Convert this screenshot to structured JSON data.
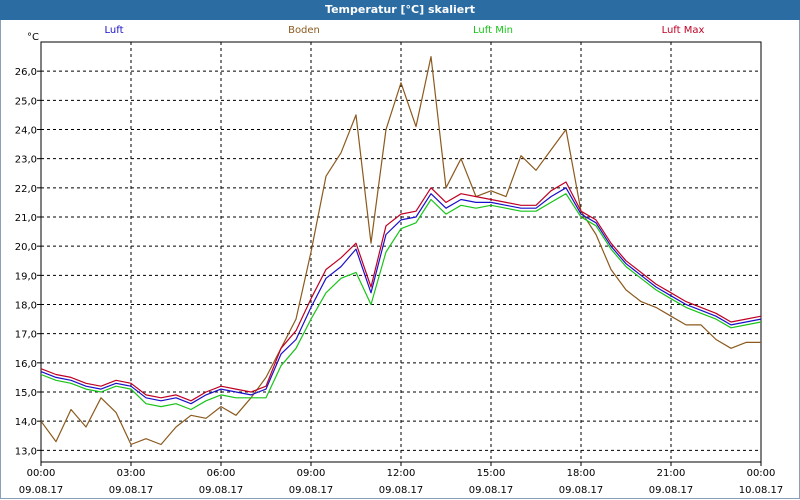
{
  "window": {
    "title": "Temperatur [°C] skaliert"
  },
  "chart_data": {
    "type": "line",
    "title": "Temperatur [°C] skaliert",
    "ylabel": "°C",
    "xlabel": "",
    "ylim": [
      12.6,
      27.0
    ],
    "xlim": [
      0,
      24
    ],
    "grid": true,
    "legend_position": "top",
    "y_ticks": [
      "13,0",
      "14,0",
      "15,0",
      "16,0",
      "17,0",
      "18,0",
      "19,0",
      "20,0",
      "21,0",
      "22,0",
      "23,0",
      "24,0",
      "25,0",
      "26,0"
    ],
    "x_ticks": [
      {
        "time": "00:00",
        "date": "09.08.17"
      },
      {
        "time": "03:00",
        "date": "09.08.17"
      },
      {
        "time": "06:00",
        "date": "09.08.17"
      },
      {
        "time": "09:00",
        "date": "09.08.17"
      },
      {
        "time": "12:00",
        "date": "09.08.17"
      },
      {
        "time": "15:00",
        "date": "09.08.17"
      },
      {
        "time": "18:00",
        "date": "09.08.17"
      },
      {
        "time": "21:00",
        "date": "09.08.17"
      },
      {
        "time": "00:00",
        "date": "10.08.17"
      }
    ],
    "x_hours": [
      0,
      0.5,
      1,
      1.5,
      2,
      2.5,
      3,
      3.5,
      4,
      4.5,
      5,
      5.5,
      6,
      6.5,
      7,
      7.5,
      8,
      8.5,
      9,
      9.5,
      10,
      10.5,
      11,
      11.5,
      12,
      12.5,
      13,
      13.5,
      14,
      14.5,
      15,
      15.5,
      16,
      16.5,
      17,
      17.5,
      18,
      18.5,
      19,
      19.5,
      20,
      20.5,
      21,
      21.5,
      22,
      22.5,
      23,
      23.5,
      24
    ],
    "series": [
      {
        "name": "Luft",
        "color": "#1a10c8",
        "values": [
          15.7,
          15.5,
          15.4,
          15.2,
          15.1,
          15.3,
          15.2,
          14.8,
          14.7,
          14.8,
          14.6,
          14.9,
          15.1,
          15.0,
          14.9,
          15.1,
          16.3,
          16.8,
          17.9,
          18.9,
          19.3,
          19.9,
          18.4,
          20.4,
          20.9,
          21.0,
          21.8,
          21.3,
          21.6,
          21.5,
          21.5,
          21.4,
          21.3,
          21.3,
          21.7,
          22.0,
          21.1,
          20.8,
          20.0,
          19.4,
          19.0,
          18.6,
          18.3,
          18.0,
          17.8,
          17.6,
          17.3,
          17.4,
          17.5
        ]
      },
      {
        "name": "Boden",
        "color": "#8b5a1e",
        "values": [
          14.0,
          13.3,
          14.4,
          13.8,
          14.8,
          14.3,
          13.2,
          13.4,
          13.2,
          13.8,
          14.2,
          14.1,
          14.5,
          14.2,
          14.8,
          15.5,
          16.5,
          17.5,
          19.8,
          22.4,
          23.2,
          24.5,
          20.1,
          24.0,
          25.6,
          24.1,
          26.5,
          22.0,
          23.0,
          21.7,
          21.9,
          21.7,
          23.1,
          22.6,
          23.3,
          24.0,
          21.2,
          20.4,
          19.2,
          18.5,
          18.1,
          17.9,
          17.6,
          17.3,
          17.3,
          16.8,
          16.5,
          16.7,
          16.7
        ]
      },
      {
        "name": "Luft Min",
        "color": "#18c418",
        "values": [
          15.6,
          15.4,
          15.3,
          15.1,
          15.0,
          15.2,
          15.1,
          14.6,
          14.5,
          14.6,
          14.4,
          14.7,
          14.9,
          14.8,
          14.8,
          14.8,
          15.9,
          16.5,
          17.5,
          18.4,
          18.9,
          19.1,
          18.0,
          19.8,
          20.6,
          20.8,
          21.6,
          21.1,
          21.4,
          21.3,
          21.4,
          21.3,
          21.2,
          21.2,
          21.5,
          21.8,
          21.0,
          20.7,
          19.9,
          19.3,
          18.9,
          18.5,
          18.2,
          17.9,
          17.7,
          17.5,
          17.2,
          17.3,
          17.4
        ]
      },
      {
        "name": "Luft Max",
        "color": "#c00024",
        "values": [
          15.8,
          15.6,
          15.5,
          15.3,
          15.2,
          15.4,
          15.3,
          14.9,
          14.8,
          14.9,
          14.7,
          15.0,
          15.2,
          15.1,
          15.0,
          15.2,
          16.5,
          17.1,
          18.2,
          19.2,
          19.6,
          20.1,
          18.6,
          20.7,
          21.1,
          21.2,
          22.0,
          21.5,
          21.8,
          21.7,
          21.6,
          21.5,
          21.4,
          21.4,
          21.9,
          22.2,
          21.2,
          20.9,
          20.1,
          19.5,
          19.1,
          18.7,
          18.4,
          18.1,
          17.9,
          17.7,
          17.4,
          17.5,
          17.6
        ]
      }
    ]
  }
}
